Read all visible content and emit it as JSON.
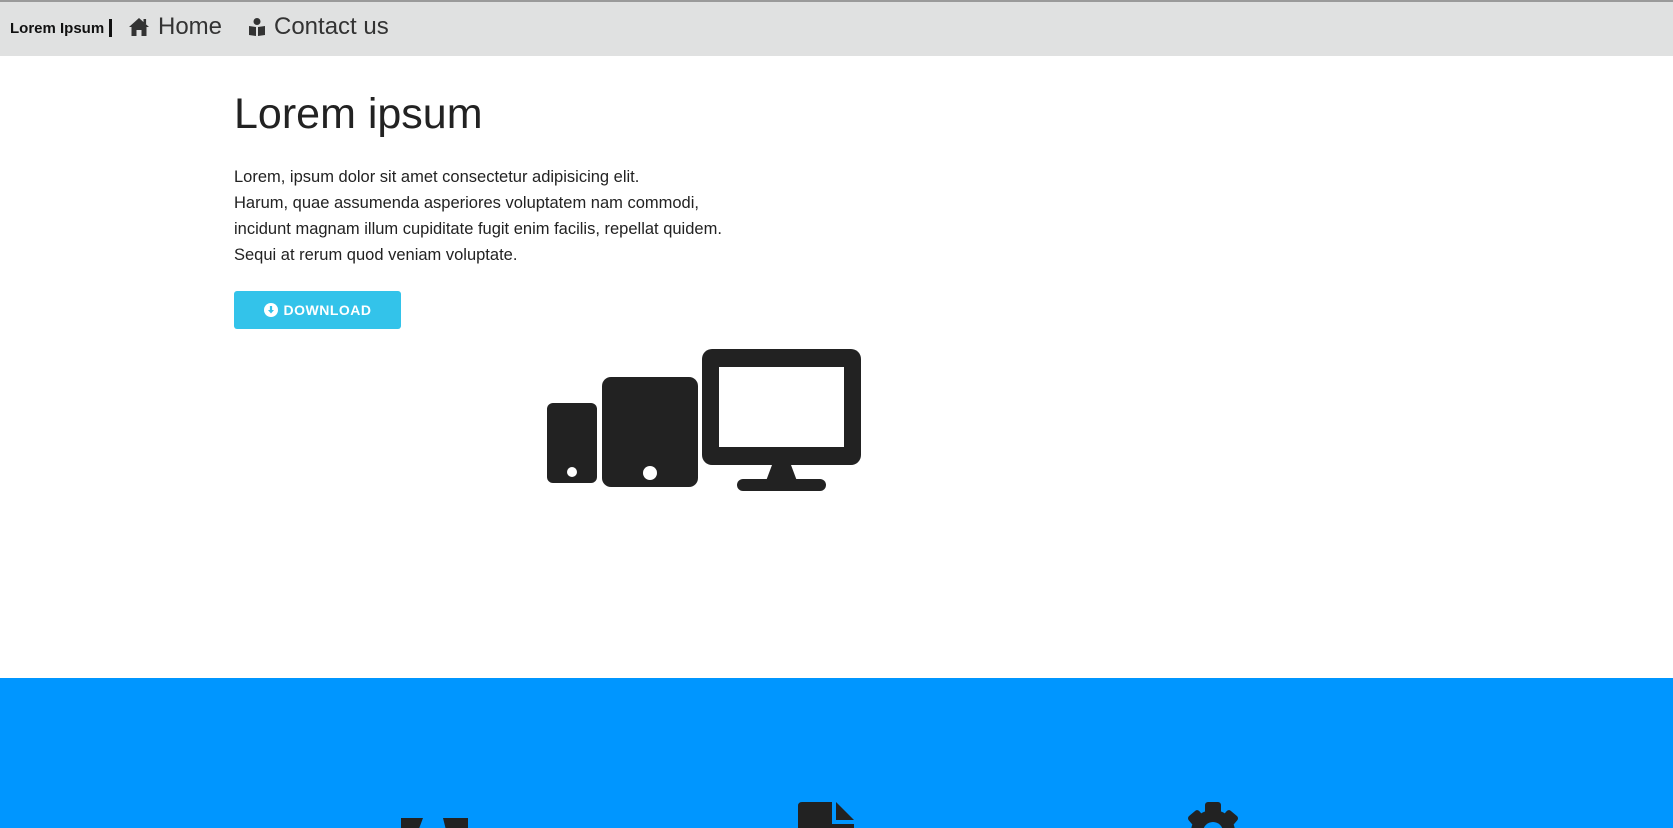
{
  "navbar": {
    "brand": "Lorem Ipsum",
    "links": [
      {
        "label": "Home",
        "icon": "home-icon"
      },
      {
        "label": "Contact us",
        "icon": "address-book-icon"
      }
    ]
  },
  "hero": {
    "title": "Lorem ipsum",
    "paragraph_lines": [
      "Lorem, ipsum dolor sit amet consectetur adipisicing elit.",
      "Harum, quae assumenda asperiores voluptatem nam commodi,",
      "incidunt magnam illum cupiditate fugit enim facilis, repellat quidem.",
      "Sequi at rerum quod veniam voluptate."
    ],
    "download_label": "DOWNLOAD",
    "download_icon": "arrow-circle-down-icon",
    "illustration_icon": "devices-icon"
  },
  "features": {
    "icons": [
      "feature-icon-1",
      "file-icon",
      "gear-icon"
    ]
  },
  "colors": {
    "navbar_bg": "#e0e1e1",
    "button_bg": "#33c3ea",
    "band_bg": "#0096ff",
    "text": "#222222"
  }
}
